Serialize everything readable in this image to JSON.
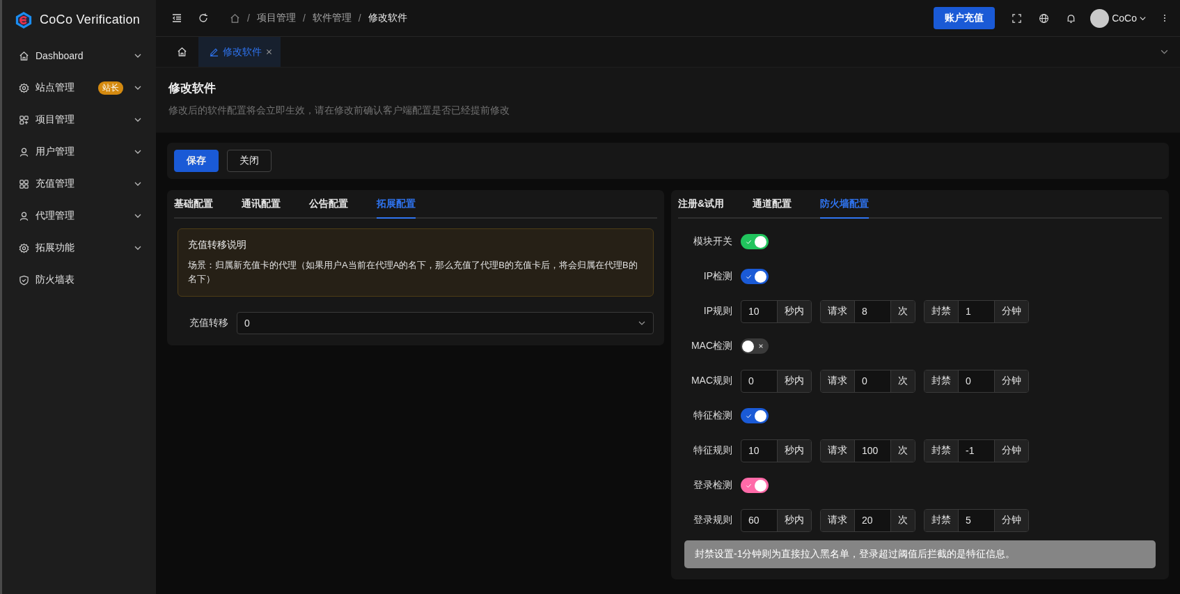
{
  "app": {
    "name": "CoCo Verification"
  },
  "sidebar": {
    "items": [
      {
        "label": "Dashboard",
        "expandable": true
      },
      {
        "label": "站点管理",
        "expandable": true,
        "badge": "站长"
      },
      {
        "label": "项目管理",
        "expandable": true
      },
      {
        "label": "用户管理",
        "expandable": true
      },
      {
        "label": "充值管理",
        "expandable": true
      },
      {
        "label": "代理管理",
        "expandable": true
      },
      {
        "label": "拓展功能",
        "expandable": true
      },
      {
        "label": "防火墙表",
        "expandable": false
      }
    ]
  },
  "header": {
    "breadcrumb_separator": "/",
    "breadcrumb": [
      "项目管理",
      "软件管理",
      "修改软件"
    ],
    "recharge_button": "账户充值",
    "user": "CoCo"
  },
  "page_tabs": [
    {
      "label": "修改软件",
      "selected": true
    }
  ],
  "page": {
    "title": "修改软件",
    "subtitle": "修改后的软件配置将会立即生效，请在修改前确认客户端配置是否已经提前修改"
  },
  "actions": {
    "save": "保存",
    "close": "关闭"
  },
  "left_panel": {
    "tabs": [
      {
        "label": "基础配置",
        "selected": false
      },
      {
        "label": "通讯配置",
        "selected": false
      },
      {
        "label": "公告配置",
        "selected": false
      },
      {
        "label": "拓展配置",
        "selected": true
      }
    ],
    "notice": {
      "title": "充值转移说明",
      "text": "场景：归属新充值卡的代理（如果用户A当前在代理A的名下，那么充值了代理B的充值卡后，将会归属在代理B的名下）"
    },
    "field": {
      "label": "充值转移",
      "value": "0"
    }
  },
  "right_panel": {
    "tabs": [
      {
        "label": "注册&试用",
        "selected": false
      },
      {
        "label": "通道配置",
        "selected": false
      },
      {
        "label": "防火墙配置",
        "selected": true
      }
    ],
    "rows": [
      {
        "kind": "toggle",
        "label": "模块开关",
        "on": true,
        "color": "#21c45d"
      },
      {
        "kind": "toggle",
        "label": "IP检测",
        "on": true,
        "color": "#1a5ad6"
      },
      {
        "kind": "rule",
        "label": "IP规则",
        "groups": [
          {
            "value": "10",
            "suffix": "秒内"
          },
          {
            "prefix": "请求",
            "value": "8",
            "suffix": "次"
          },
          {
            "prefix": "封禁",
            "value": "1",
            "suffix": "分钟"
          }
        ]
      },
      {
        "kind": "toggle",
        "label": "MAC检测",
        "on": false
      },
      {
        "kind": "rule",
        "label": "MAC规则",
        "groups": [
          {
            "value": "0",
            "suffix": "秒内"
          },
          {
            "prefix": "请求",
            "value": "0",
            "suffix": "次"
          },
          {
            "prefix": "封禁",
            "value": "0",
            "suffix": "分钟"
          }
        ]
      },
      {
        "kind": "toggle",
        "label": "特征检测",
        "on": true,
        "color": "#1a5ad6"
      },
      {
        "kind": "rule",
        "label": "特征规则",
        "groups": [
          {
            "value": "10",
            "suffix": "秒内"
          },
          {
            "prefix": "请求",
            "value": "100",
            "suffix": "次"
          },
          {
            "prefix": "封禁",
            "value": "-1",
            "suffix": "分钟"
          }
        ]
      },
      {
        "kind": "toggle",
        "label": "登录检测",
        "on": true,
        "color": "#ff6aa8"
      },
      {
        "kind": "rule",
        "label": "登录规则",
        "groups": [
          {
            "value": "60",
            "suffix": "秒内"
          },
          {
            "prefix": "请求",
            "value": "20",
            "suffix": "次"
          },
          {
            "prefix": "封禁",
            "value": "5",
            "suffix": "分钟"
          }
        ]
      }
    ],
    "note": "封禁设置-1分钟则为直接拉入黑名单，登录超过阈值后拦截的是特征信息。"
  }
}
